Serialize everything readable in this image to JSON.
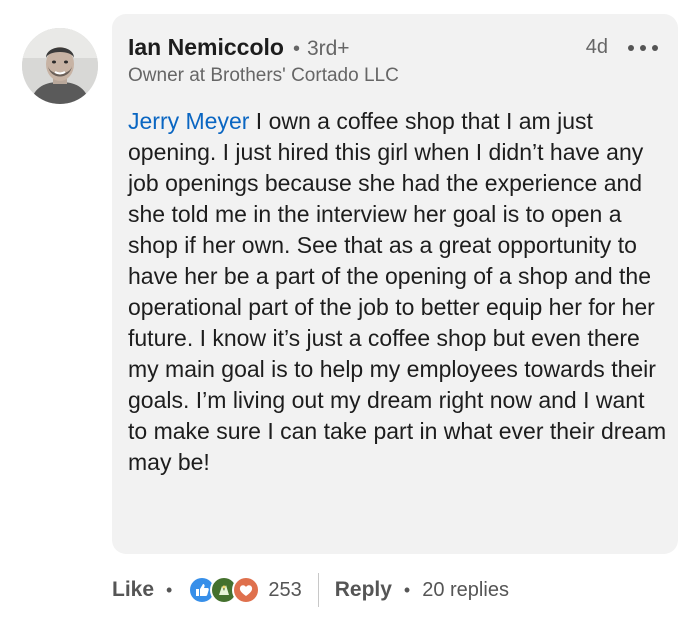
{
  "comment": {
    "author": {
      "name": "Ian Nemiccolo",
      "degree_separator": "•",
      "degree": "3rd+",
      "headline": "Owner at Brothers' Cortado LLC",
      "avatar_icon": "profile-photo"
    },
    "time_ago": "4d",
    "more_icon": "ellipsis-icon",
    "mention": "Jerry Meyer",
    "text": " I own a coffee shop that I am just opening. I just hired this girl when I didn’t have any job openings because she had the experience and she told me in the interview her goal is to open a shop if her own.  See that as a great opportunity to have her be a part of the opening of a shop and the operational part of the job to better equip her for her future. I know it’s just a coffee shop but even there my main goal is to help my employees towards their goals. I’m living out my dream right now and I want to make sure I can take part in what ever their dream may be!"
  },
  "actions": {
    "like_label": "Like",
    "separator": "•",
    "reactions": [
      "like-reaction-icon",
      "celebrate-reaction-icon",
      "love-reaction-icon"
    ],
    "reaction_count": "253",
    "reply_label": "Reply",
    "replies_label": "20 replies"
  },
  "colors": {
    "bubble_bg": "#f2f2f2",
    "mention": "#0a66c2",
    "like": "#378fe9",
    "celebrate": "#44712e",
    "love": "#df704d"
  }
}
